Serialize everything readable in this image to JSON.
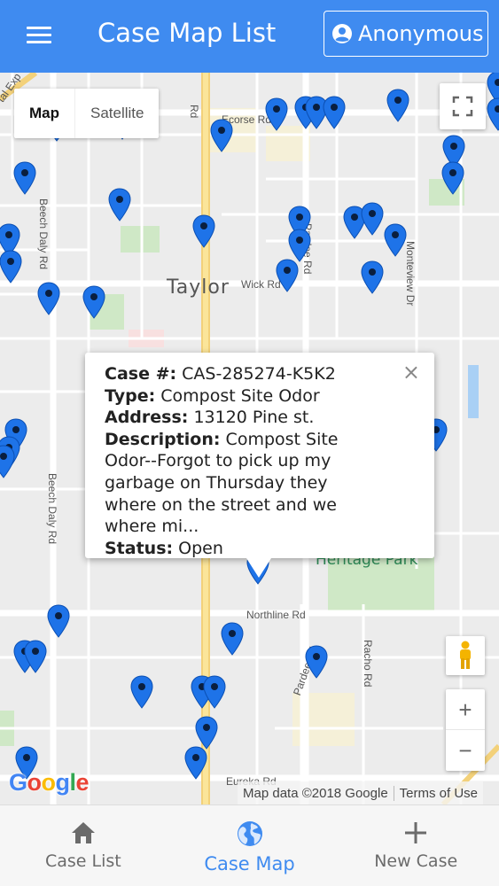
{
  "header": {
    "title": "Case Map List",
    "account_label": "Anonymous",
    "accent_color": "#3f8bf0"
  },
  "map": {
    "type_control": {
      "map_label": "Map",
      "satellite_label": "Satellite",
      "selected": "Map"
    },
    "labels": {
      "city": "Taylor",
      "park": "Heritage Park",
      "ecorse_rd": "Ecorse Rd",
      "wick_rd": "Wick Rd",
      "northline_rd": "Northline Rd",
      "eureka_rd": "Eureka Rd",
      "beech_daly_rd_1": "Beech Daly Rd",
      "beech_daly_rd_2": "Beech Daly Rd",
      "pardee_rd_1": "Pardee Rd",
      "pardee_rd_2": "Pardee Rd",
      "monteview_dr": "Monteview Dr",
      "racho_rd": "Racho Rd",
      "rd_fragment": "Rd",
      "telegraph_fragment": "tal Exp"
    },
    "zoom_in_label": "+",
    "zoom_out_label": "−",
    "google_logo": [
      "G",
      "o",
      "o",
      "g",
      "l",
      "e"
    ],
    "google_colors": [
      "#4285f4",
      "#ea4335",
      "#fbbc05",
      "#4285f4",
      "#34a853",
      "#ea4335"
    ],
    "attribution": "Map data ©2018 Google",
    "terms_label": "Terms of Use",
    "pin_color": "#1e73e8"
  },
  "info_window": {
    "case_label": "Case #:",
    "case_value": "CAS-285274-K5K2",
    "type_label": "Type:",
    "type_value": "Compost Site Odor",
    "address_label": "Address:",
    "address_value": "13120 Pine st.",
    "description_label": "Description:",
    "description_value": "Compost Site Odor--Forgot to pick up my garbage on Thursday they where on the street and we where mi...",
    "status_label": "Status:",
    "status_value": "Open",
    "close_label": "×"
  },
  "bottom_nav": {
    "items": [
      {
        "label": "Case List",
        "icon": "home-icon"
      },
      {
        "label": "Case Map",
        "icon": "globe-icon",
        "active": true
      },
      {
        "label": "New Case",
        "icon": "plus-icon"
      }
    ]
  }
}
